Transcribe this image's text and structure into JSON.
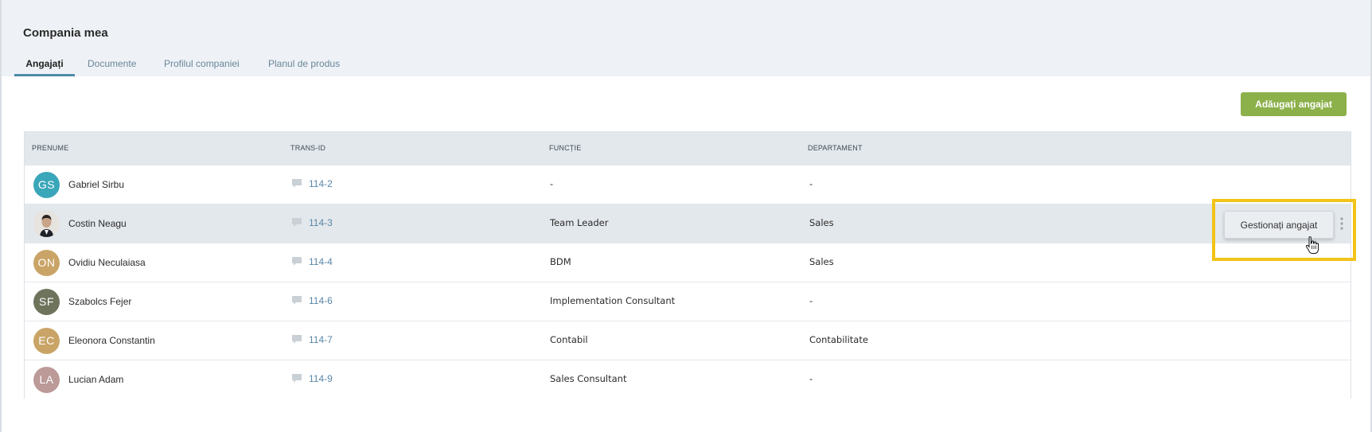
{
  "page": {
    "title": "Compania mea"
  },
  "tabs": [
    {
      "label": "Angajați",
      "active": true
    },
    {
      "label": "Documente",
      "active": false
    },
    {
      "label": "Profilul companiei",
      "active": false
    },
    {
      "label": "Planul de produs",
      "active": false
    }
  ],
  "toolbar": {
    "add_employee_label": "Adăugați angajat"
  },
  "table": {
    "columns": [
      "PRENUME",
      "TRANS-ID",
      "FUNCȚIE",
      "DEPARTAMENT"
    ],
    "rows": [
      {
        "initials": "GS",
        "name": "Gabriel Sirbu",
        "trans_id": "114-2",
        "function": "-",
        "department": "-",
        "avatar_color": "#3aa6b9"
      },
      {
        "initials": "",
        "name": "Costin Neagu",
        "trans_id": "114-3",
        "function": "Team Leader",
        "department": "Sales",
        "avatar_color": "#d8d2cc",
        "photo": true
      },
      {
        "initials": "ON",
        "name": "Ovidiu Neculaiasa",
        "trans_id": "114-4",
        "function": "BDM",
        "department": "Sales",
        "avatar_color": "#c9a466"
      },
      {
        "initials": "SF",
        "name": "Szabolcs Fejer",
        "trans_id": "114-6",
        "function": "Implementation Consultant",
        "department": "-",
        "avatar_color": "#6e745c"
      },
      {
        "initials": "EC",
        "name": "Eleonora Constantin",
        "trans_id": "114-7",
        "function": "Contabil",
        "department": "Contabilitate",
        "avatar_color": "#c9a466"
      },
      {
        "initials": "LA",
        "name": "Lucian Adam",
        "trans_id": "114-9",
        "function": "Sales Consultant",
        "department": "-",
        "avatar_color": "#bb9a98"
      }
    ]
  },
  "row_actions": {
    "manage_employee_label": "Gestionați angajat"
  },
  "icons": {
    "message": "chat-bubble-icon",
    "more": "kebab-menu-icon",
    "pointer": "hand-cursor-icon"
  },
  "colors": {
    "accent_green": "#8cb04a",
    "link_blue": "#5a87a8",
    "active_tab_underline": "#4c8aa6",
    "highlight_yellow": "#f2c318"
  }
}
